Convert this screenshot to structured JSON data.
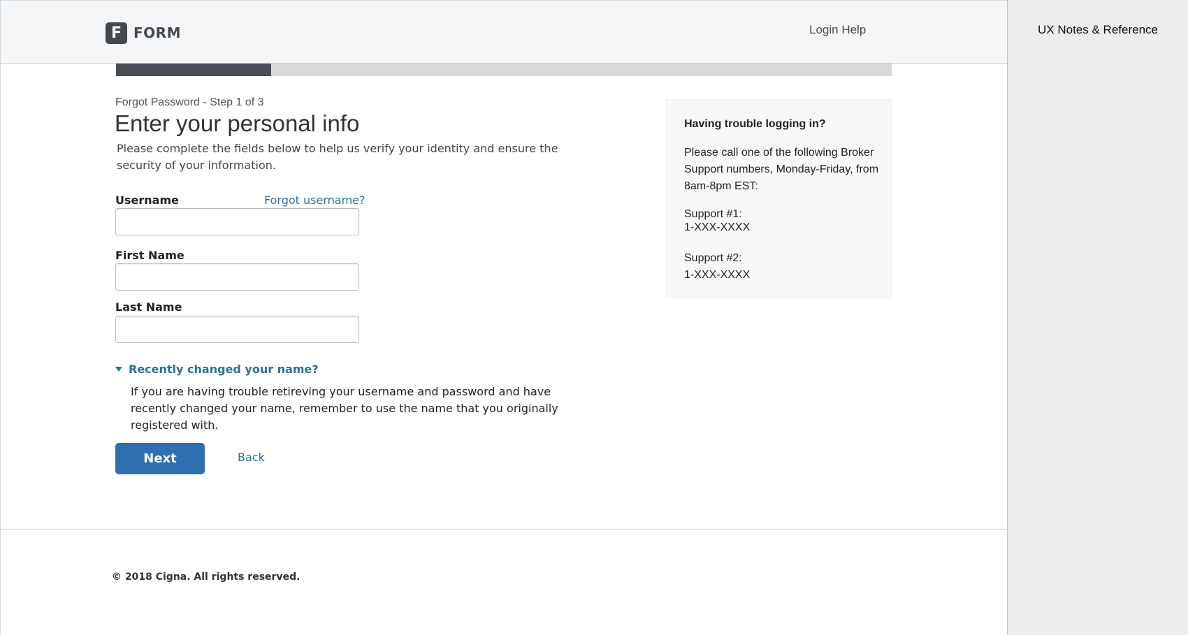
{
  "header": {
    "logo_letter": "F",
    "logo_text": "FORM",
    "login_help": "Login Help"
  },
  "progress": {
    "current_step": 1,
    "total_steps": 3,
    "fraction": 0.2
  },
  "form": {
    "step_label": "Forgot Password - Step 1 of 3",
    "title": "Enter your personal info",
    "intro": "Please complete the fields below to help us verify your identity and ensure the security of your information.",
    "username_label": "Username",
    "forgot_username": "Forgot username?",
    "username_value": "",
    "first_name_label": "First Name",
    "first_name_value": "",
    "last_name_label": "Last Name",
    "last_name_value": "",
    "disclosure_label": "Recently changed your name?",
    "disclosure_text": "If you are having trouble retireving your username and password and have recently changed your name, remember to use the name that you originally registered with.",
    "next_label": "Next",
    "back_label": "Back"
  },
  "help": {
    "title": "Having trouble logging in?",
    "text": "Please call one of the following Broker Support numbers, Monday-Friday, from 8am-8pm EST:",
    "support1_label": "Support #1:",
    "support1_number": "1-XXX-XXXX",
    "support2_label": "Support #2:",
    "support2_number": "1-XXX-XXXX"
  },
  "footer": {
    "copyright": "© 2018 Cigna. All rights reserved."
  },
  "side_panel": {
    "title": "UX Notes & Reference"
  },
  "colors": {
    "primary_button": "#2d6faf",
    "link": "#2f6f96",
    "progress_fill": "#4a4f57",
    "progress_track": "#d9d9d9"
  }
}
